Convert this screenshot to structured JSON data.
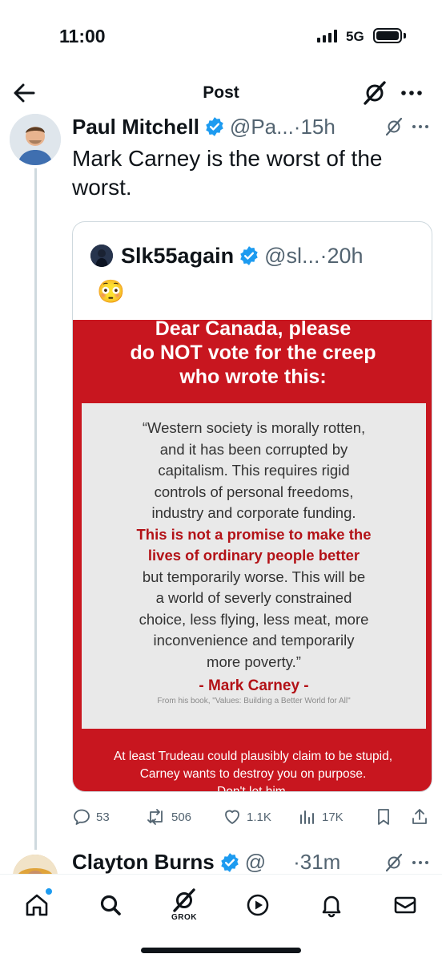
{
  "status_bar": {
    "time": "11:00",
    "network": "5G"
  },
  "header": {
    "title": "Post"
  },
  "post": {
    "author_name": "Paul Mitchell",
    "handle": "@Pa...",
    "separator": "·",
    "time": "15h",
    "text": "Mark Carney is the worst of the worst."
  },
  "quote": {
    "author_name": "Slk55again",
    "handle": "@sl...",
    "separator": "·",
    "time": "20h",
    "emoji": "😳",
    "image": {
      "headline": [
        "Dear Canada, please",
        "do NOT vote for the creep",
        "who wrote this:"
      ],
      "quote_lines": [
        {
          "text": "“Western society is morally rotten,",
          "emphasis": false
        },
        {
          "text": "and it has been corrupted by",
          "emphasis": false
        },
        {
          "text": "capitalism. This requires rigid",
          "emphasis": false
        },
        {
          "text": "controls of personal freedoms,",
          "emphasis": false
        },
        {
          "text": "industry and corporate funding.",
          "emphasis": false
        },
        {
          "text": "This is not a promise to make the",
          "emphasis": true
        },
        {
          "text": "lives of ordinary people better",
          "emphasis": true
        },
        {
          "text": "but temporarily worse. This will be",
          "emphasis": false
        },
        {
          "text": "a world of severly constrained",
          "emphasis": false
        },
        {
          "text": "choice, less flying, less meat, more",
          "emphasis": false
        },
        {
          "text": "inconvenience and temporarily",
          "emphasis": false
        },
        {
          "text": "more poverty.”",
          "emphasis": false
        }
      ],
      "attribution": "- Mark Carney -",
      "source": "From his book, \"Values: Building a Better World for All\"",
      "footer": [
        "At least Trudeau could plausibly claim to be stupid,",
        "Carney wants to destroy you on purpose.",
        "Don't let him."
      ]
    }
  },
  "actions": {
    "replies": "53",
    "reposts": "506",
    "likes": "1.1K",
    "views": "17K"
  },
  "next_post": {
    "author_name": "Clayton Burns",
    "handle": "@",
    "time": "·31m"
  },
  "bottom_nav": {
    "grok_label": "GROK"
  },
  "colors": {
    "accent": "#1d9bf0",
    "image_red": "#c8161f",
    "quote_red": "#b31217",
    "muted": "#536471"
  }
}
